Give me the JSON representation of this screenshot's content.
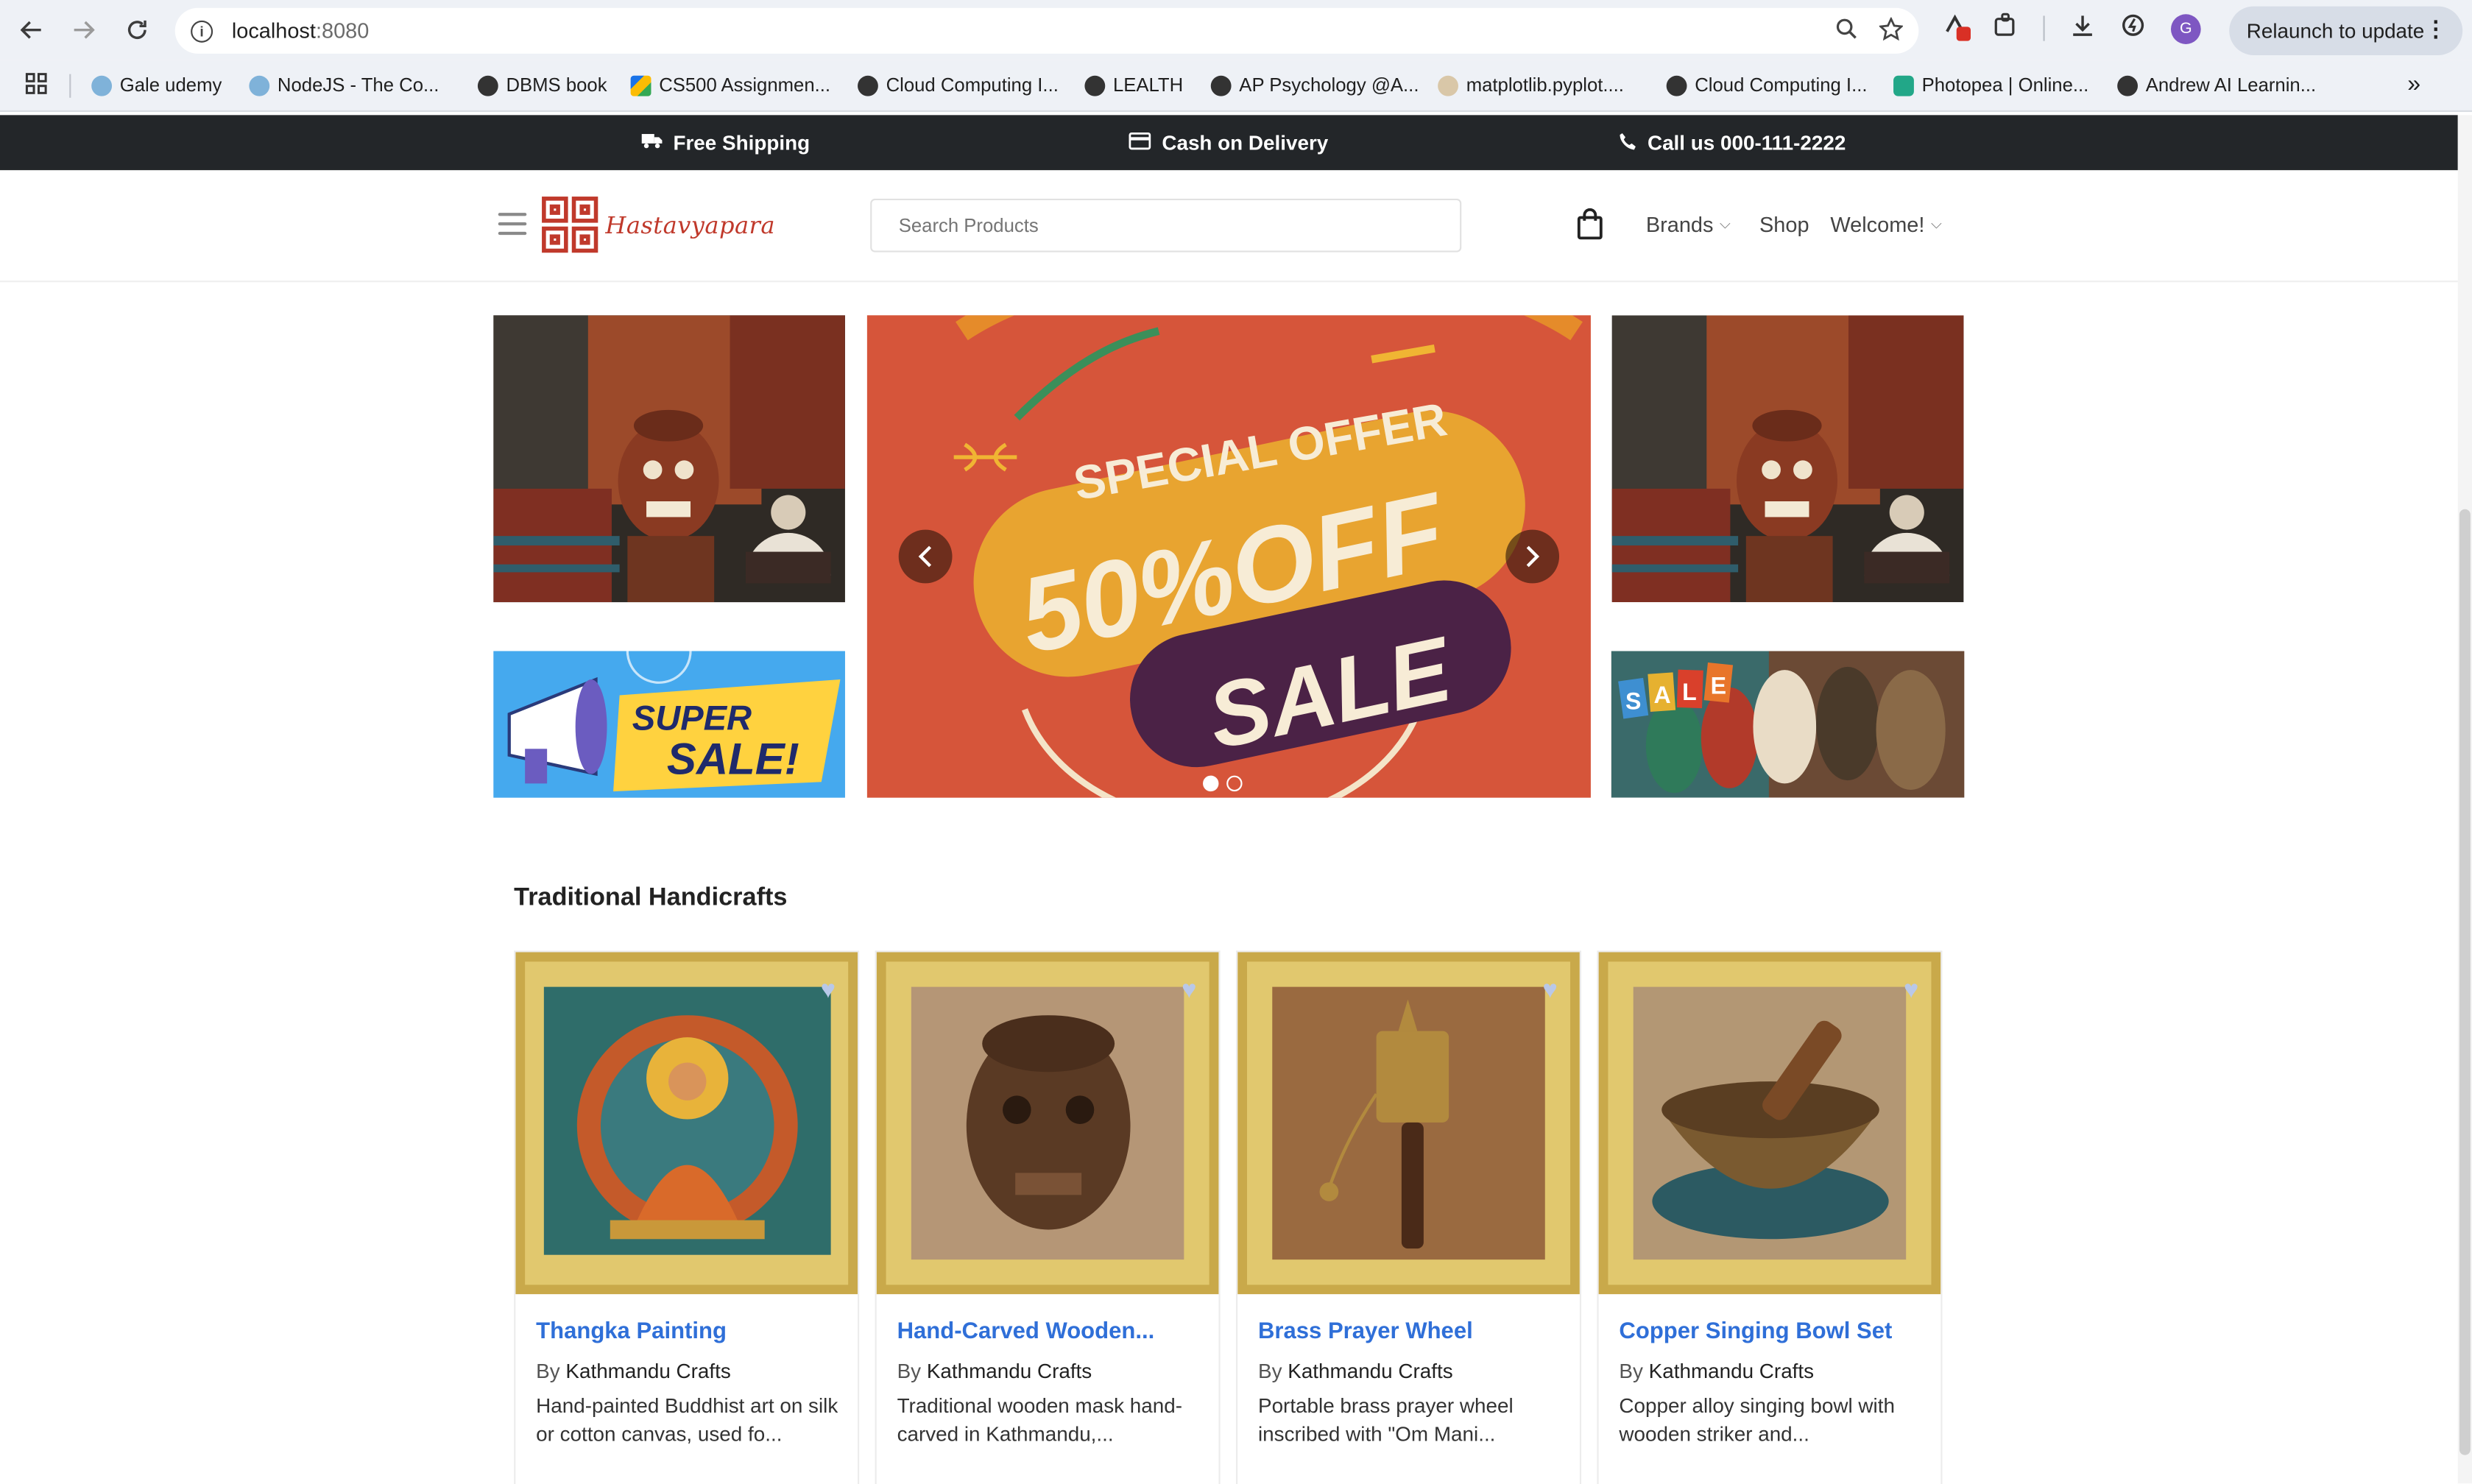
{
  "browser": {
    "url_host": "localhost",
    "url_port": ":8080",
    "relaunch_label": "Relaunch to update",
    "avatar_letter": "G",
    "bookmarks": [
      {
        "label": "Gale udemy",
        "icon": "gear-favicon"
      },
      {
        "label": "NodeJS - The Co...",
        "icon": "gear-favicon"
      },
      {
        "label": "DBMS book",
        "icon": "globe-favicon"
      },
      {
        "label": "CS500 Assignmen...",
        "icon": "drive-favicon"
      },
      {
        "label": "Cloud Computing I...",
        "icon": "globe-favicon"
      },
      {
        "label": "LEALTH",
        "icon": "globe-favicon"
      },
      {
        "label": "AP Psychology @A...",
        "icon": "globe-favicon"
      },
      {
        "label": "matplotlib.pyplot....",
        "icon": "matplotlib-favicon"
      },
      {
        "label": "Cloud Computing I...",
        "icon": "globe-favicon"
      },
      {
        "label": "Photopea | Online...",
        "icon": "photopea-favicon"
      },
      {
        "label": "Andrew AI Learnin...",
        "icon": "globe-favicon"
      }
    ]
  },
  "topbar": {
    "shipping": "Free Shipping",
    "cod": "Cash on Delivery",
    "call": "Call us 000-111-2222"
  },
  "header": {
    "brand": "Hastavyapara",
    "search_placeholder": "Search Products",
    "nav": {
      "brands": "Brands",
      "shop": "Shop",
      "welcome": "Welcome!"
    }
  },
  "hero": {
    "line1": "SPECIAL OFFER",
    "line2": "50%OFF",
    "line3": "SALE",
    "slides": 2,
    "active_slide": 1
  },
  "side_banners": {
    "super_sale_text": "SUPER SALE!",
    "sale_tags": [
      "S",
      "A",
      "L",
      "E"
    ]
  },
  "section": {
    "title": "Traditional Handicrafts"
  },
  "products": [
    {
      "title": "Thangka Painting",
      "by": "By",
      "seller": "Kathmandu Crafts",
      "desc": "Hand-painted Buddhist art on silk or cotton canvas, used fo..."
    },
    {
      "title": "Hand-Carved Wooden...",
      "by": "By",
      "seller": "Kathmandu Crafts",
      "desc": "Traditional wooden mask hand-carved in Kathmandu,..."
    },
    {
      "title": "Brass Prayer Wheel",
      "by": "By",
      "seller": "Kathmandu Crafts",
      "desc": "Portable brass prayer wheel inscribed with \"Om Mani..."
    },
    {
      "title": "Copper Singing Bowl Set",
      "by": "By",
      "seller": "Kathmandu Crafts",
      "desc": "Copper alloy singing bowl with wooden striker and..."
    }
  ],
  "colors": {
    "topbar": "#232629",
    "accent_link": "#2f6fd8",
    "brand_red": "#c0392b",
    "hero_bg": "#d6553a"
  }
}
